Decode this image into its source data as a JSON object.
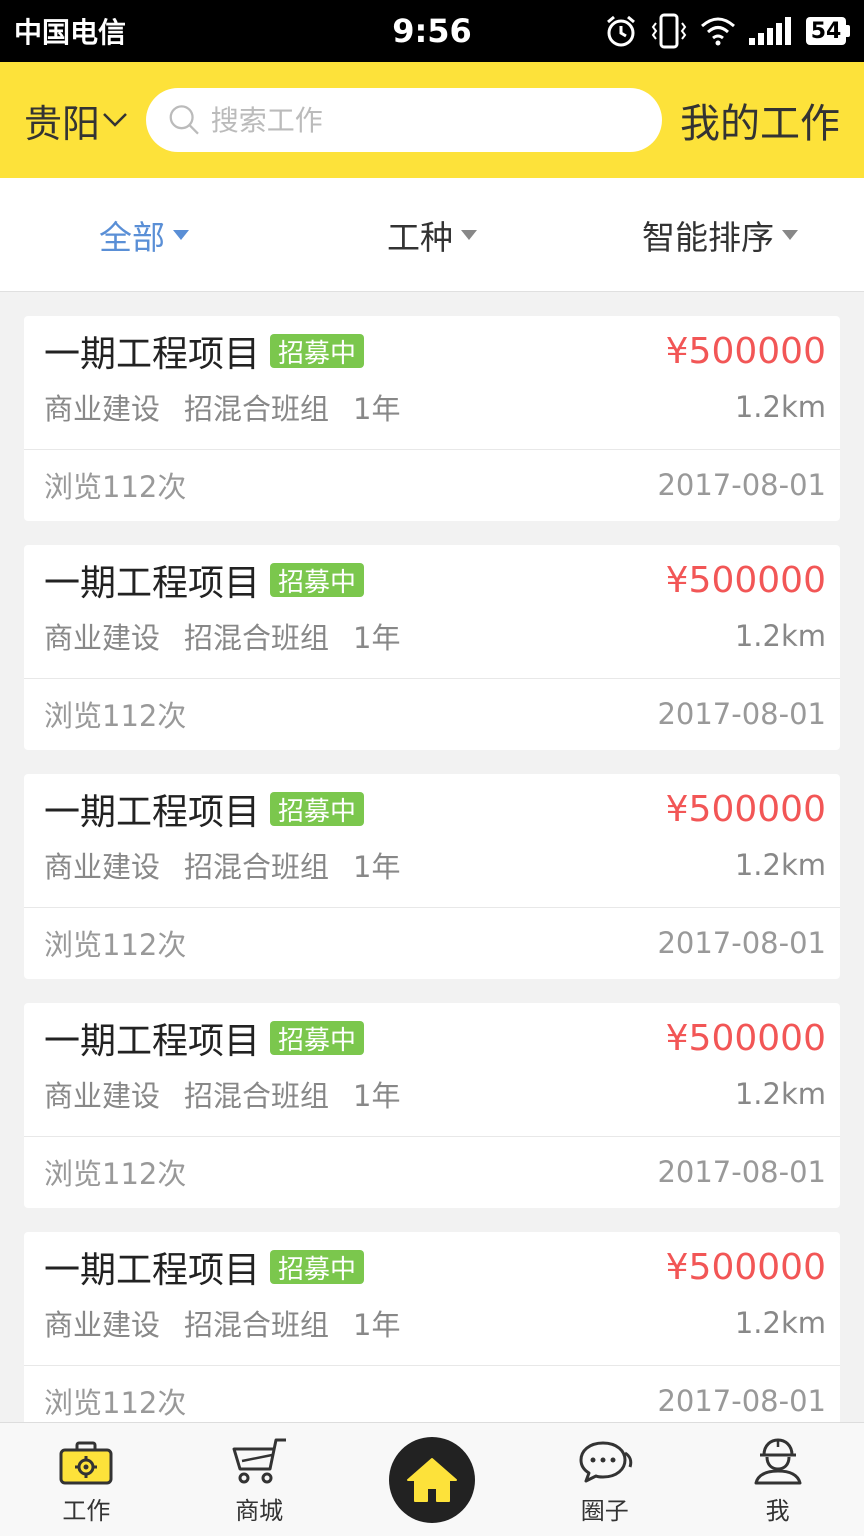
{
  "status": {
    "carrier": "中国电信",
    "time": "9:56",
    "battery": "54"
  },
  "header": {
    "city": "贵阳",
    "search_placeholder": "搜索工作",
    "my_jobs": "我的工作"
  },
  "filters": [
    {
      "label": "全部",
      "active": true
    },
    {
      "label": "工种",
      "active": false
    },
    {
      "label": "智能排序",
      "active": false
    }
  ],
  "jobs": [
    {
      "title": "一期工程项目",
      "badge": "招募中",
      "price": "¥500000",
      "category": "商业建设",
      "team": "招混合班组",
      "duration": "1年",
      "distance": "1.2km",
      "views": "浏览112次",
      "date": "2017-08-01"
    },
    {
      "title": "一期工程项目",
      "badge": "招募中",
      "price": "¥500000",
      "category": "商业建设",
      "team": "招混合班组",
      "duration": "1年",
      "distance": "1.2km",
      "views": "浏览112次",
      "date": "2017-08-01"
    },
    {
      "title": "一期工程项目",
      "badge": "招募中",
      "price": "¥500000",
      "category": "商业建设",
      "team": "招混合班组",
      "duration": "1年",
      "distance": "1.2km",
      "views": "浏览112次",
      "date": "2017-08-01"
    },
    {
      "title": "一期工程项目",
      "badge": "招募中",
      "price": "¥500000",
      "category": "商业建设",
      "team": "招混合班组",
      "duration": "1年",
      "distance": "1.2km",
      "views": "浏览112次",
      "date": "2017-08-01"
    },
    {
      "title": "一期工程项目",
      "badge": "招募中",
      "price": "¥500000",
      "category": "商业建设",
      "team": "招混合班组",
      "duration": "1年",
      "distance": "1.2km",
      "views": "浏览112次",
      "date": "2017-08-01"
    }
  ],
  "tabs": {
    "work": "工作",
    "shop": "商城",
    "circle": "圈子",
    "me": "我"
  },
  "icons": {
    "work": "toolbox-gear-icon",
    "shop": "cart-icon",
    "home": "home-icon",
    "circle": "chat-bubbles-icon",
    "me": "worker-helmet-icon"
  },
  "colors": {
    "accent_yellow": "#fde23a",
    "active_filter": "#5a8fd6",
    "price_red": "#f25656",
    "badge_green": "#7bc74d"
  }
}
